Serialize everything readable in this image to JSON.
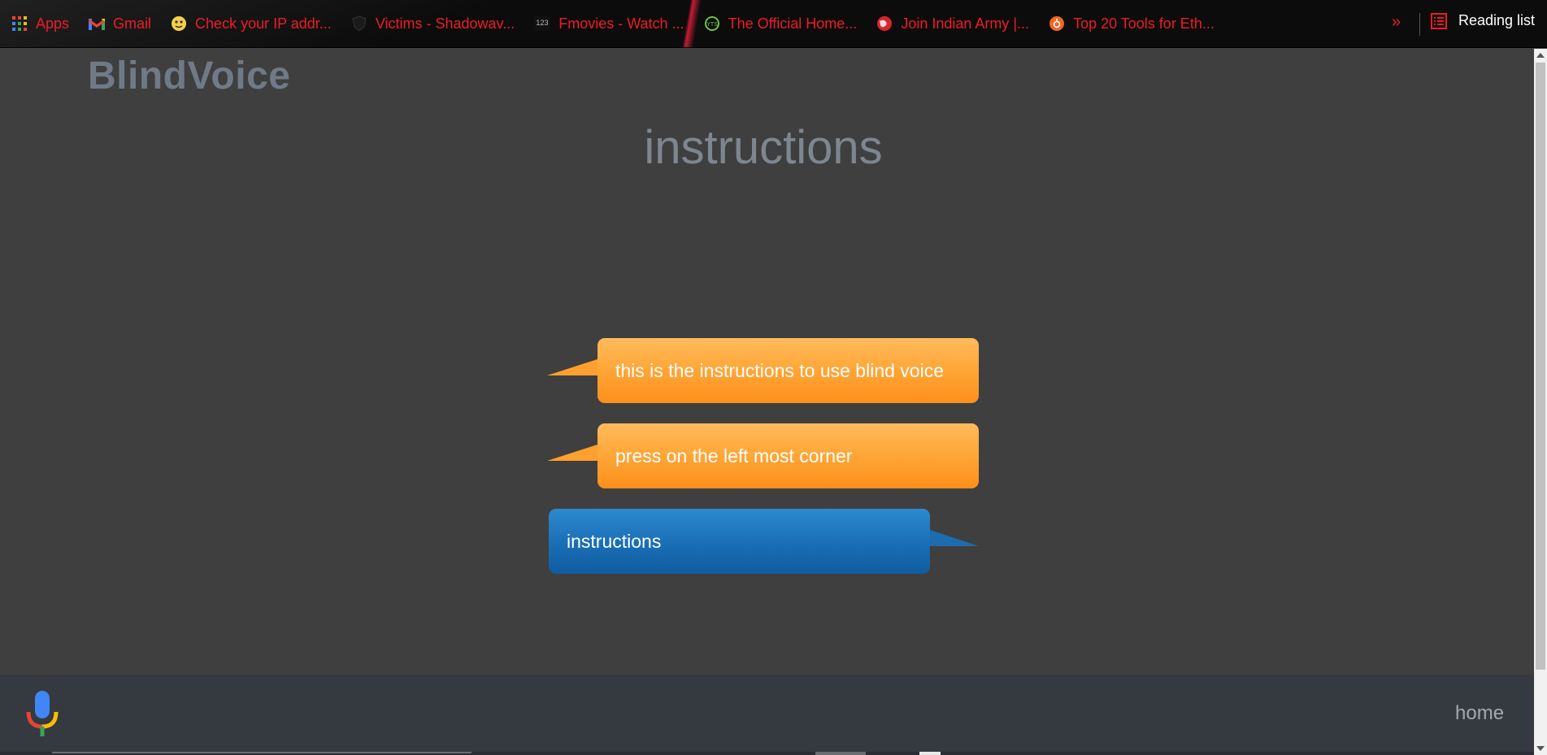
{
  "bookmarks": {
    "items": [
      {
        "label": "Apps",
        "icon": "apps-grid-icon"
      },
      {
        "label": "Gmail",
        "icon": "gmail-icon"
      },
      {
        "label": "Check your IP addr...",
        "icon": "ip-check-icon"
      },
      {
        "label": "Victims - Shadowav...",
        "icon": "shield-site-icon"
      },
      {
        "label": "Fmovies - Watch ...",
        "icon": "fmovies-123-icon"
      },
      {
        "label": "The Official Home...",
        "icon": "yts-icon"
      },
      {
        "label": "Join Indian Army |...",
        "icon": "globe-icon"
      },
      {
        "label": "Top 20 Tools for Eth...",
        "icon": "tools-site-icon"
      }
    ],
    "more_label": "»",
    "reading_list_label": "Reading list"
  },
  "page": {
    "brand": "BlindVoice",
    "title": "instructions",
    "messages": [
      {
        "side": "left",
        "color": "orange",
        "text": "this is the instructions to use blind voice"
      },
      {
        "side": "left",
        "color": "orange",
        "text": "press on the left most corner"
      },
      {
        "side": "right",
        "color": "blue",
        "text": "instructions"
      }
    ]
  },
  "footer": {
    "home_label": "home",
    "mic_icon": "microphone-icon"
  },
  "colors": {
    "bookmark_text": "#ee1c25",
    "page_bg": "#3f3f3f",
    "footer_bg": "#353940",
    "orange_bubble": "#ffa83a",
    "blue_bubble": "#1a6eb5"
  }
}
